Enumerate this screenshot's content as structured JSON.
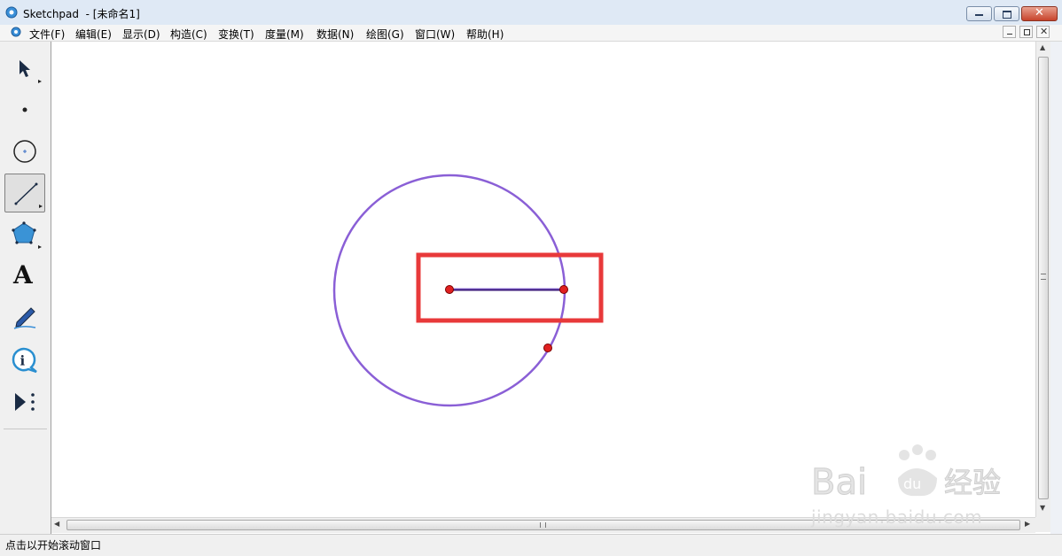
{
  "window": {
    "title": "Sketchpad  - [未命名1]",
    "buttons": [
      "minimize",
      "maximize",
      "close"
    ]
  },
  "menubar": {
    "items": [
      {
        "label": "文件(F)"
      },
      {
        "label": "编辑(E)"
      },
      {
        "label": "显示(D)"
      },
      {
        "label": "构造(C)"
      },
      {
        "label": "变换(T)"
      },
      {
        "label": "度量(M)"
      },
      {
        "label": "数据(N)"
      },
      {
        "label": "绘图(G)"
      },
      {
        "label": "窗口(W)"
      },
      {
        "label": "帮助(H)"
      }
    ]
  },
  "toolbox": {
    "tools": [
      {
        "name": "arrow-select-tool",
        "icon": "arrow-icon"
      },
      {
        "name": "point-tool",
        "icon": "point-icon"
      },
      {
        "name": "compass-tool",
        "icon": "circle-icon"
      },
      {
        "name": "straightedge-tool",
        "icon": "segment-icon",
        "active": true
      },
      {
        "name": "polygon-tool",
        "icon": "pentagon-icon"
      },
      {
        "name": "text-tool",
        "icon": "text-a-icon",
        "label": "A"
      },
      {
        "name": "marker-tool",
        "icon": "marker-pen-icon"
      },
      {
        "name": "information-tool",
        "icon": "info-icon"
      },
      {
        "name": "custom-tool",
        "icon": "play-more-icon"
      }
    ]
  },
  "canvas": {
    "circle_color": "#8a5fd6",
    "segment_color": "#3b1a7a",
    "point_color": "#e02020",
    "highlight_box_color": "#e8393a"
  },
  "statusbar": {
    "text": "点击以开始滚动窗口"
  },
  "watermark": {
    "text": "jingyan.baidu.com",
    "brand": "Baidu经验"
  }
}
